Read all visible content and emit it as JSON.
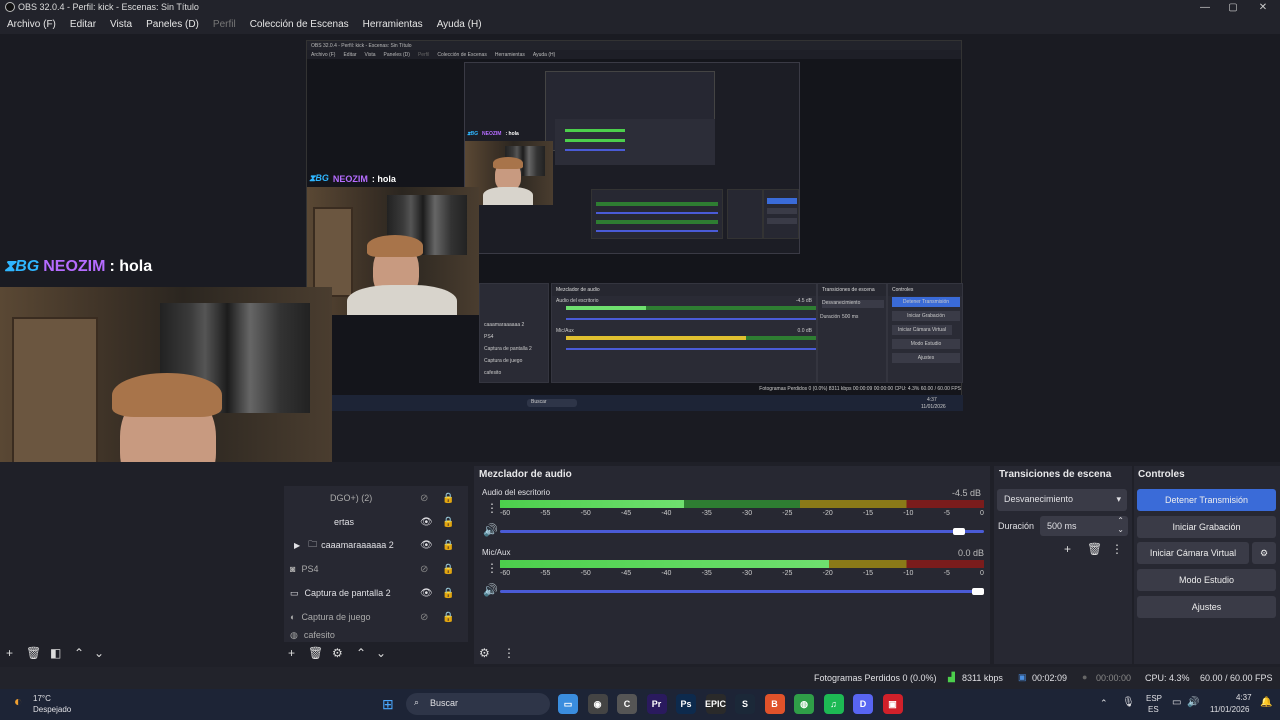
{
  "window": {
    "title": "OBS 32.0.4 - Perfil: kick - Escenas: Sin Título",
    "minimize": "—",
    "maximize": "▢",
    "close": "✕"
  },
  "menu": [
    "Archivo (F)",
    "Editar",
    "Vista",
    "Paneles (D)",
    "Perfil",
    "Colección de Escenas",
    "Herramientas",
    "Ayuda (H)"
  ],
  "chat": {
    "logo": "⧗BG",
    "user": "NEOZIM",
    "message": ": hola"
  },
  "nested": {
    "title": "OBS 32.0.4 - Perfil: kick - Escenas: Sin Título",
    "mixer_title": "Mezclador de audio",
    "transitions_title": "Transiciones de escena",
    "controls_title": "Controles",
    "track1": "Audio del escritorio",
    "track2": "Mic/Aux",
    "db1": "-4.5 dB",
    "db2": "0.0 dB",
    "fade": "Desvanecimiento",
    "duration_label": "Duración",
    "duration_value": "500 ms",
    "buttons": [
      "Detener Transmisión",
      "Iniciar Grabación",
      "Iniciar Cámara Virtual",
      "Modo Estudio",
      "Ajustes"
    ],
    "sources": [
      "caaamaraaaaaa 2",
      "PS4",
      "Captura de pantalla 2",
      "Captura de juego",
      "cafesito"
    ],
    "search": "Buscar",
    "status": "Fotogramas Perdidos 0 (0.0%)  8311 kbps  00:00:09  00:00:00  CPU: 4.3%  60.00 / 60.00 FPS",
    "clock": "4:37",
    "date": "11/01/2026",
    "chat_user": "NEOZIM",
    "chat_msg": ": hola"
  },
  "sources": {
    "items": [
      {
        "label": "DGO+) (2)",
        "visible": false
      },
      {
        "label": "ertas",
        "visible": true
      },
      {
        "label": "caaamaraaaaaa 2",
        "visible": true
      },
      {
        "label": "PS4",
        "visible": false
      },
      {
        "label": "Captura de pantalla 2",
        "visible": true
      },
      {
        "label": "Captura de juego",
        "visible": false
      },
      {
        "label": "cafesito",
        "visible": false
      }
    ]
  },
  "mixer": {
    "title": "Mezclador de audio",
    "tracks": [
      {
        "name": "Audio del escritorio",
        "db": "-4.5 dB",
        "level": 0.38,
        "volume": 0.96
      },
      {
        "name": "Mic/Aux",
        "db": "0.0 dB",
        "level": 0.68,
        "volume": 1.0
      }
    ],
    "ticks": [
      "-60",
      "-55",
      "-50",
      "-45",
      "-40",
      "-35",
      "-30",
      "-25",
      "-20",
      "-15",
      "-10",
      "-5",
      "0"
    ]
  },
  "transitions": {
    "title": "Transiciones de escena",
    "selected": "Desvanecimiento",
    "duration_label": "Duración",
    "duration_value": "500 ms"
  },
  "controls": {
    "title": "Controles",
    "stop_stream": "Detener Transmisión",
    "start_record": "Iniciar Grabación",
    "start_vcam": "Iniciar Cámara Virtual",
    "studio_mode": "Modo Estudio",
    "settings": "Ajustes"
  },
  "status": {
    "dropped": "Fotogramas Perdidos 0 (0.0%)",
    "bitrate": "8311 kbps",
    "stream_time": "00:02:09",
    "record_time": "00:00:00",
    "cpu": "CPU: 4.3%",
    "fps": "60.00 / 60.00 FPS"
  },
  "taskbar": {
    "weather_temp": "17°C",
    "weather_desc": "Despejado",
    "search": "Buscar",
    "lang": "ESP",
    "lang2": "ES",
    "time": "4:37",
    "date": "11/01/2026",
    "apps": [
      {
        "name": "files",
        "label": "▭",
        "color": "#3a8dde"
      },
      {
        "name": "obs",
        "label": "◉",
        "color": "#444"
      },
      {
        "name": "copilot",
        "label": "C",
        "color": "#555"
      },
      {
        "name": "premiere",
        "label": "Pr",
        "color": "#2a1a5e"
      },
      {
        "name": "photoshop",
        "label": "Ps",
        "color": "#0d2a4d"
      },
      {
        "name": "epic",
        "label": "EPIC",
        "color": "#2a2a2a"
      },
      {
        "name": "steam",
        "label": "S",
        "color": "#1b2838"
      },
      {
        "name": "brave",
        "label": "B",
        "color": "#e0522a"
      },
      {
        "name": "chrome",
        "label": "◍",
        "color": "#2f9e48"
      },
      {
        "name": "spotify",
        "label": "♫",
        "color": "#1db954"
      },
      {
        "name": "discord",
        "label": "D",
        "color": "#5865f2"
      },
      {
        "name": "app-red",
        "label": "▣",
        "color": "#d0202a"
      }
    ]
  }
}
